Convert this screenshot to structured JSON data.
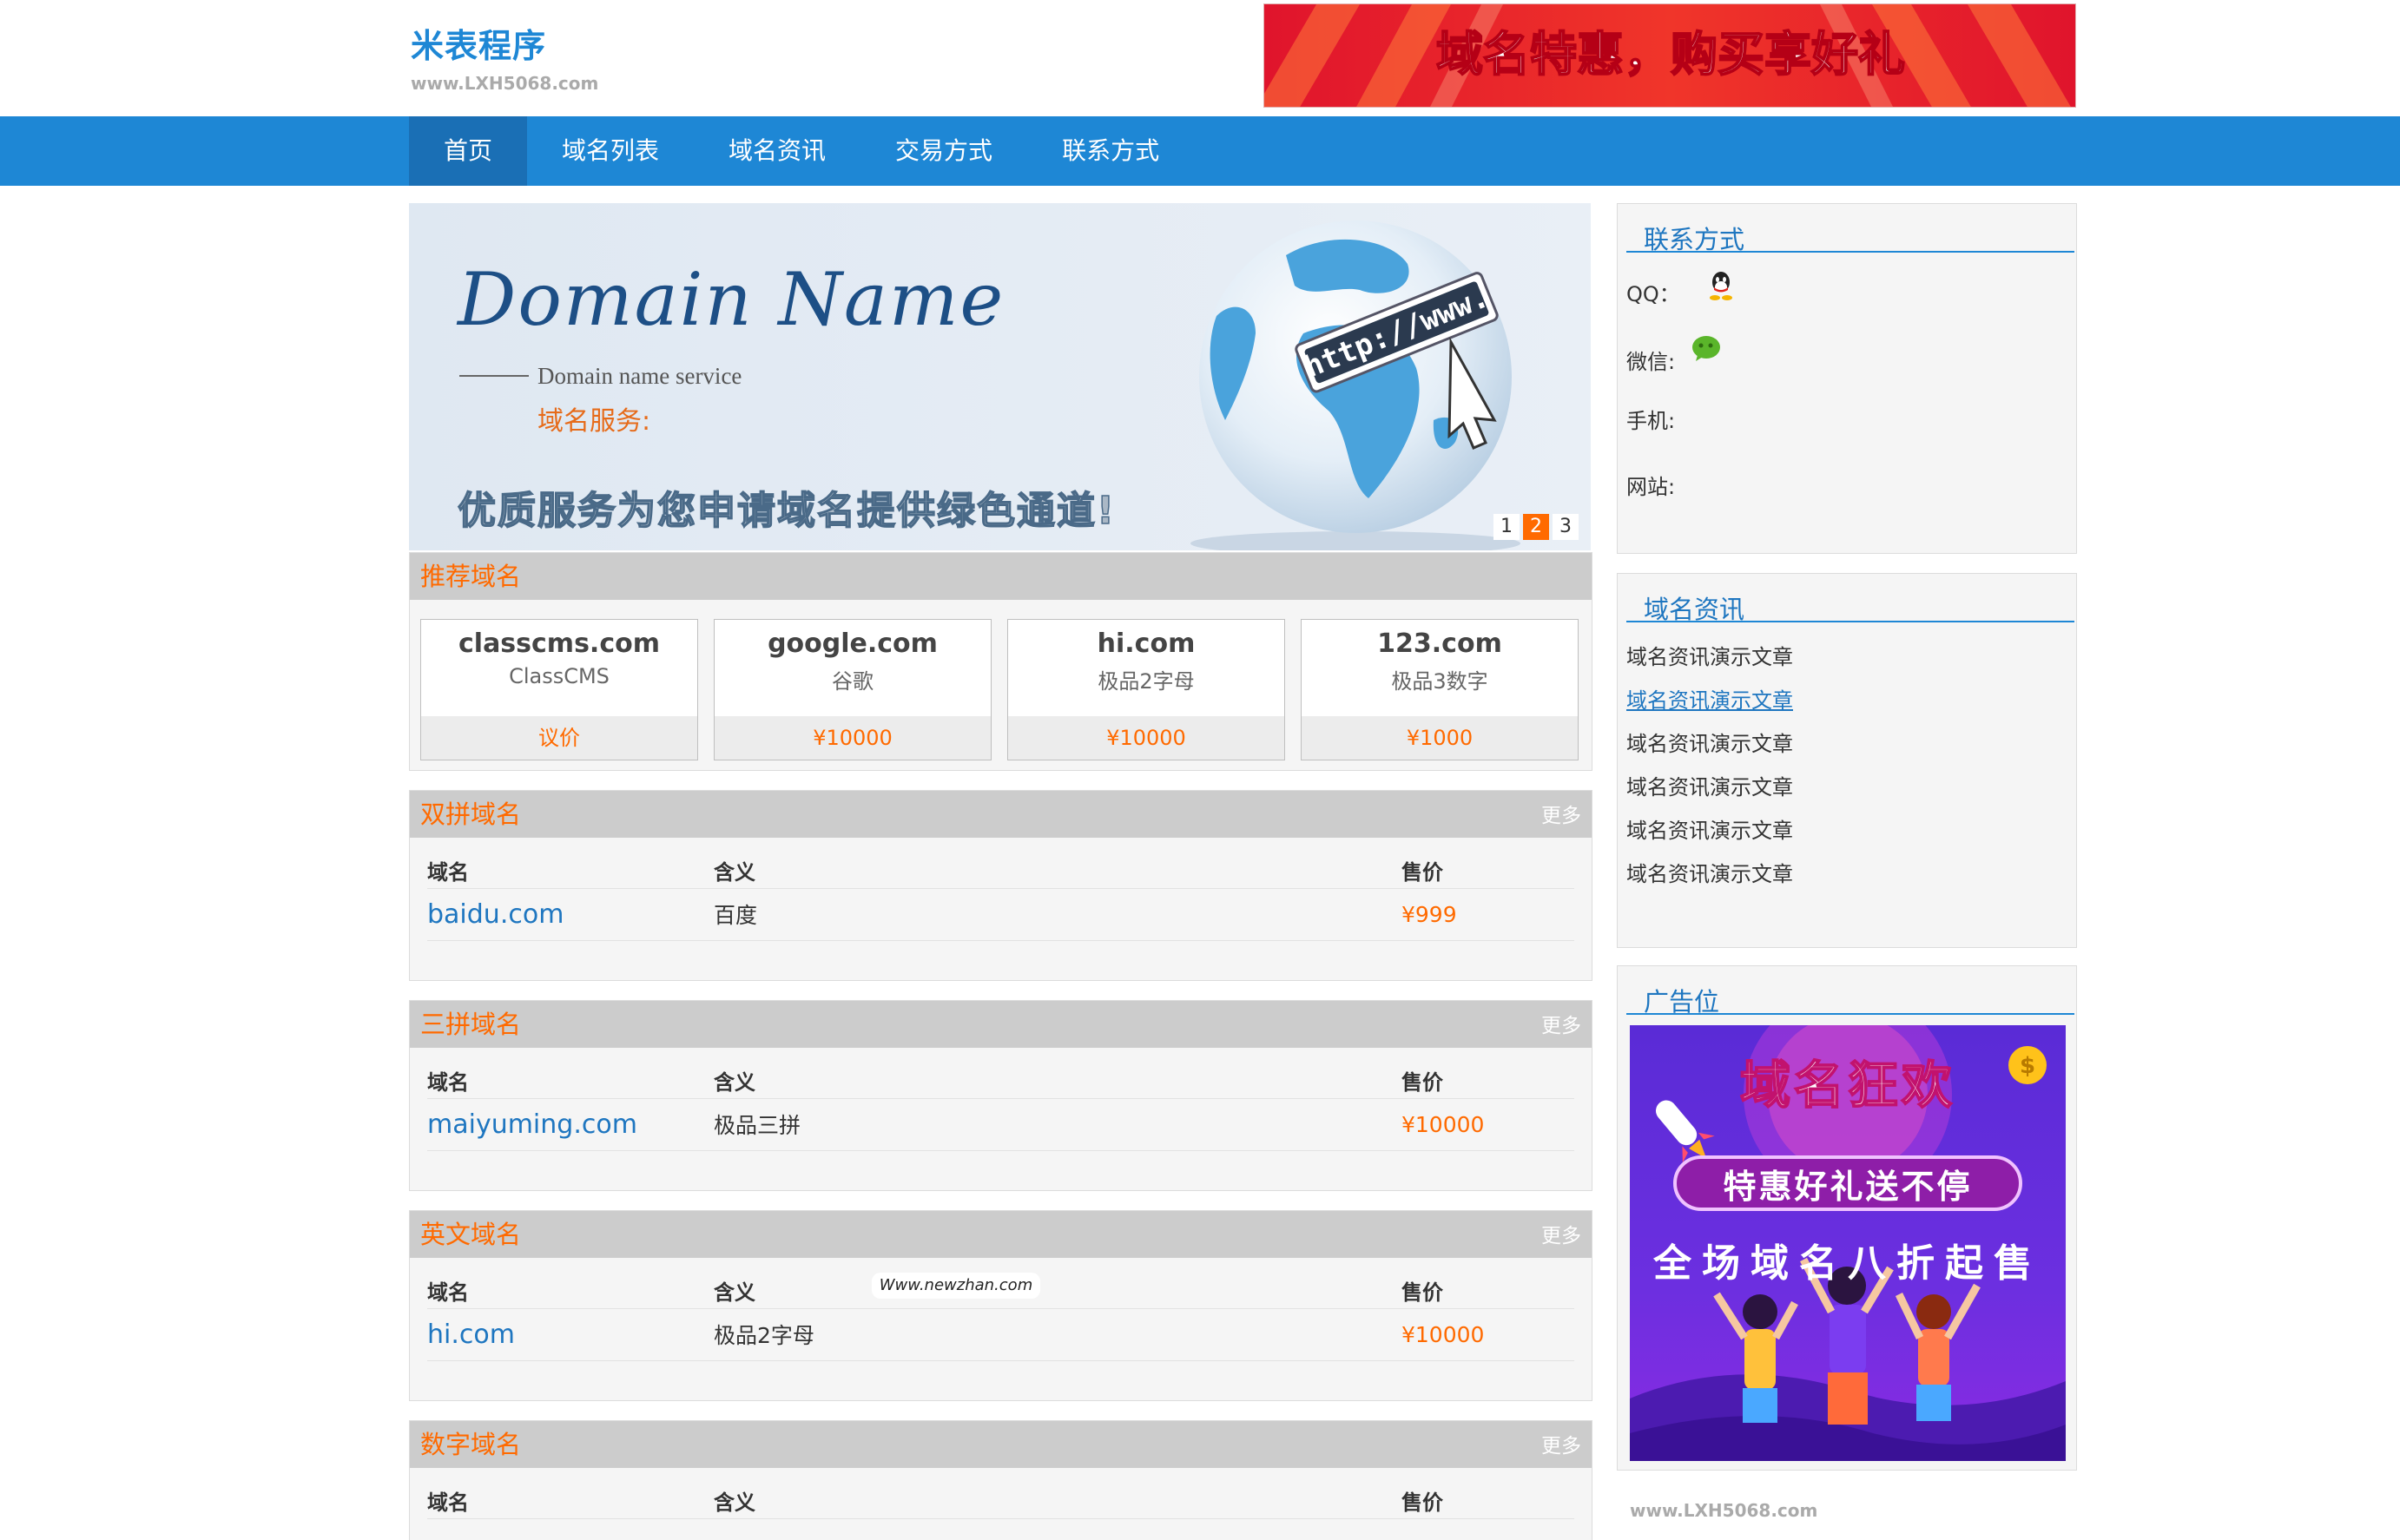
{
  "site": {
    "title": "米表程序",
    "url": "www.LXH5068.com"
  },
  "top_banner": {
    "text": "域名特惠，购买享好礼"
  },
  "nav": {
    "items": [
      "首页",
      "域名列表",
      "域名资讯",
      "交易方式",
      "联系方式"
    ],
    "active": 0
  },
  "hero": {
    "title": "Domain Name",
    "subtitle": "Domain name service",
    "subtitle_cn": "域名服务:",
    "slogan": "优质服务为您申请域名提供绿色通道!",
    "globe_text": "http://www.",
    "pages": [
      "1",
      "2",
      "3"
    ],
    "active_page": 1
  },
  "recommended": {
    "title": "推荐域名",
    "items": [
      {
        "domain": "classcms.com",
        "desc": "ClassCMS",
        "price": "议价"
      },
      {
        "domain": "google.com",
        "desc": "谷歌",
        "price": "¥10000"
      },
      {
        "domain": "hi.com",
        "desc": "极品2字母",
        "price": "¥10000"
      },
      {
        "domain": "123.com",
        "desc": "极品3数字",
        "price": "¥1000"
      }
    ]
  },
  "columns": {
    "domain": "域名",
    "meaning": "含义",
    "price": "售价"
  },
  "more_label": "更多",
  "sections": [
    {
      "title": "双拼域名",
      "rows": [
        {
          "domain": "baidu.com",
          "meaning": "百度",
          "price": "¥999"
        }
      ]
    },
    {
      "title": "三拼域名",
      "rows": [
        {
          "domain": "maiyuming.com",
          "meaning": "极品三拼",
          "price": "¥10000"
        }
      ]
    },
    {
      "title": "英文域名",
      "rows": [
        {
          "domain": "hi.com",
          "meaning": "极品2字母",
          "price": "¥10000"
        }
      ]
    },
    {
      "title": "数字域名",
      "rows": []
    }
  ],
  "watermark": "Www.newzhan.com",
  "contact": {
    "title": "联系方式",
    "qq_label": "QQ：",
    "wechat_label": "微信:",
    "phone_label": "手机:",
    "site_label": "网站:"
  },
  "news": {
    "title": "域名资讯",
    "items": [
      "域名资讯演示文章",
      "域名资讯演示文章",
      "域名资讯演示文章",
      "域名资讯演示文章",
      "域名资讯演示文章",
      "域名资讯演示文章"
    ]
  },
  "ad": {
    "title": "广告位",
    "line1": "域名狂欢",
    "line2": "特惠好礼送不停",
    "line3": "全场域名八折起售"
  },
  "footer_url": "www.LXH5068.com",
  "colors": {
    "brand_blue": "#1e87d5",
    "accent_orange": "#ff6a00",
    "panel_bg": "#f5f5f5",
    "panel_head": "#cccccc"
  }
}
